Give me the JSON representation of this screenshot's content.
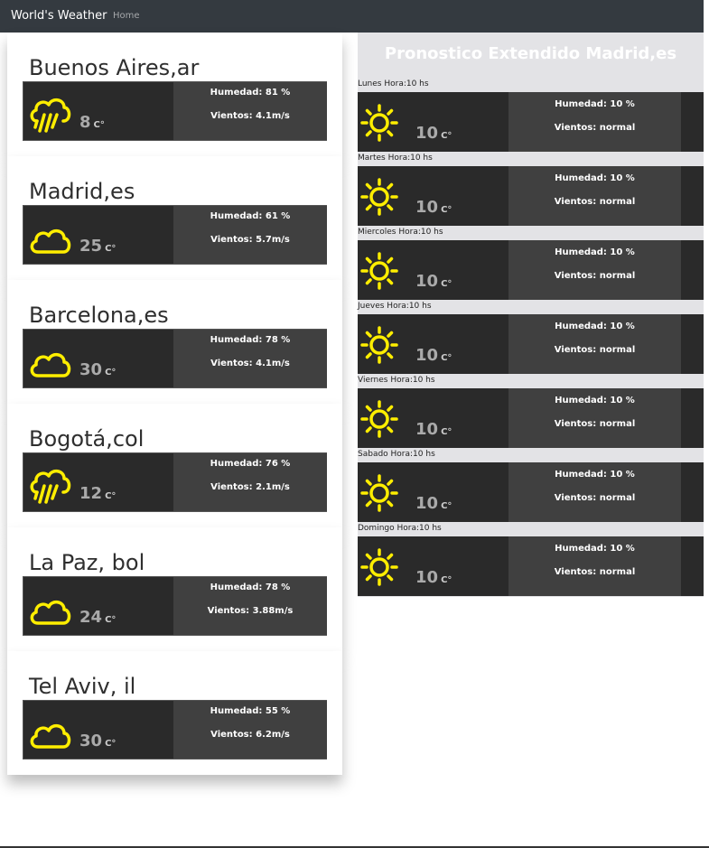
{
  "navbar": {
    "brand": "World's Weather",
    "home": "Home"
  },
  "cities": [
    {
      "name": "Buenos Aires,ar",
      "temp": "8",
      "unit": "C°",
      "humidity": "Humedad: 81 %",
      "wind": "Vientos: 4.1m/s",
      "icon": "rain-icon"
    },
    {
      "name": "Madrid,es",
      "temp": "25",
      "unit": "C°",
      "humidity": "Humedad: 61 %",
      "wind": "Vientos: 5.7m/s",
      "icon": "cloud-icon"
    },
    {
      "name": "Barcelona,es",
      "temp": "30",
      "unit": "C°",
      "humidity": "Humedad: 78 %",
      "wind": "Vientos: 4.1m/s",
      "icon": "cloud-icon"
    },
    {
      "name": "Bogotá,col",
      "temp": "12",
      "unit": "C°",
      "humidity": "Humedad: 76 %",
      "wind": "Vientos: 2.1m/s",
      "icon": "rain-icon"
    },
    {
      "name": "La Paz, bol",
      "temp": "24",
      "unit": "C°",
      "humidity": "Humedad: 78 %",
      "wind": "Vientos: 3.88m/s",
      "icon": "cloud-icon"
    },
    {
      "name": "Tel Aviv, il",
      "temp": "30",
      "unit": "C°",
      "humidity": "Humedad: 55 %",
      "wind": "Vientos: 6.2m/s",
      "icon": "cloud-icon"
    }
  ],
  "forecast": {
    "title": "Pronostico Extendido Madrid,es",
    "days": [
      {
        "label": "Lunes Hora:10 hs",
        "temp": "10",
        "unit": "C°",
        "humidity": "Humedad: 10 %",
        "wind": "Vientos: normal",
        "icon": "sun-icon"
      },
      {
        "label": "Martes Hora:10 hs",
        "temp": "10",
        "unit": "C°",
        "humidity": "Humedad: 10 %",
        "wind": "Vientos: normal",
        "icon": "sun-icon"
      },
      {
        "label": "Miercoles Hora:10 hs",
        "temp": "10",
        "unit": "C°",
        "humidity": "Humedad: 10 %",
        "wind": "Vientos: normal",
        "icon": "sun-icon"
      },
      {
        "label": "Jueves Hora:10 hs",
        "temp": "10",
        "unit": "C°",
        "humidity": "Humedad: 10 %",
        "wind": "Vientos: normal",
        "icon": "sun-icon"
      },
      {
        "label": "Viernes Hora:10 hs",
        "temp": "10",
        "unit": "C°",
        "humidity": "Humedad: 10 %",
        "wind": "Vientos: normal",
        "icon": "sun-icon"
      },
      {
        "label": "Sabado Hora:10 hs",
        "temp": "10",
        "unit": "C°",
        "humidity": "Humedad: 10 %",
        "wind": "Vientos: normal",
        "icon": "sun-icon"
      },
      {
        "label": "Domingo Hora:10 hs",
        "temp": "10",
        "unit": "C°",
        "humidity": "Humedad: 10 %",
        "wind": "Vientos: normal",
        "icon": "sun-icon"
      }
    ]
  },
  "colors": {
    "navbar": "#343a40",
    "icon": "#ffee00",
    "panel_dark": "#2a2a2a",
    "panel_info": "#404040",
    "forecast_bg": "#e3e3e6"
  }
}
